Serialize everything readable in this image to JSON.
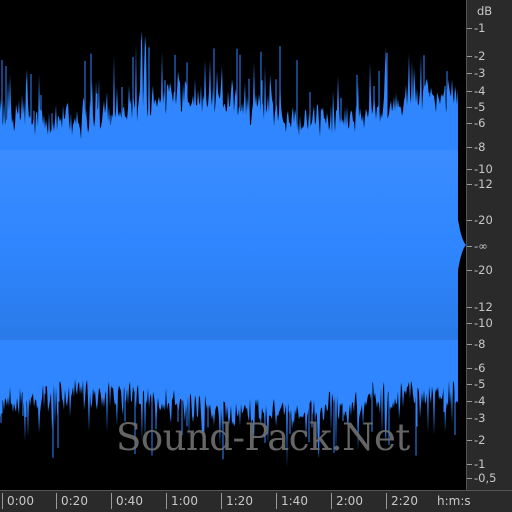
{
  "colors": {
    "waveform": "#2f86ff",
    "background": "#000000",
    "ruler": "#2a2a2a",
    "ruler_text": "#c8c8c8"
  },
  "db_ruler": {
    "unit": "dB",
    "ticks": [
      "-1",
      "-2",
      "-3",
      "-4",
      "-5",
      "-6",
      "-8",
      "-10",
      "-12",
      "-20",
      "-∞",
      "-20",
      "-12",
      "-10",
      "-8",
      "-6",
      "-5",
      "-4",
      "-3",
      "-2",
      "-1",
      "-0,5"
    ]
  },
  "time_ruler": {
    "ticks": [
      "0:00",
      "0:20",
      "0:40",
      "1:00",
      "1:20",
      "1:40",
      "2:00",
      "2:20"
    ],
    "unit": "h:m:s"
  },
  "watermark": "Sound-Pack.Net"
}
